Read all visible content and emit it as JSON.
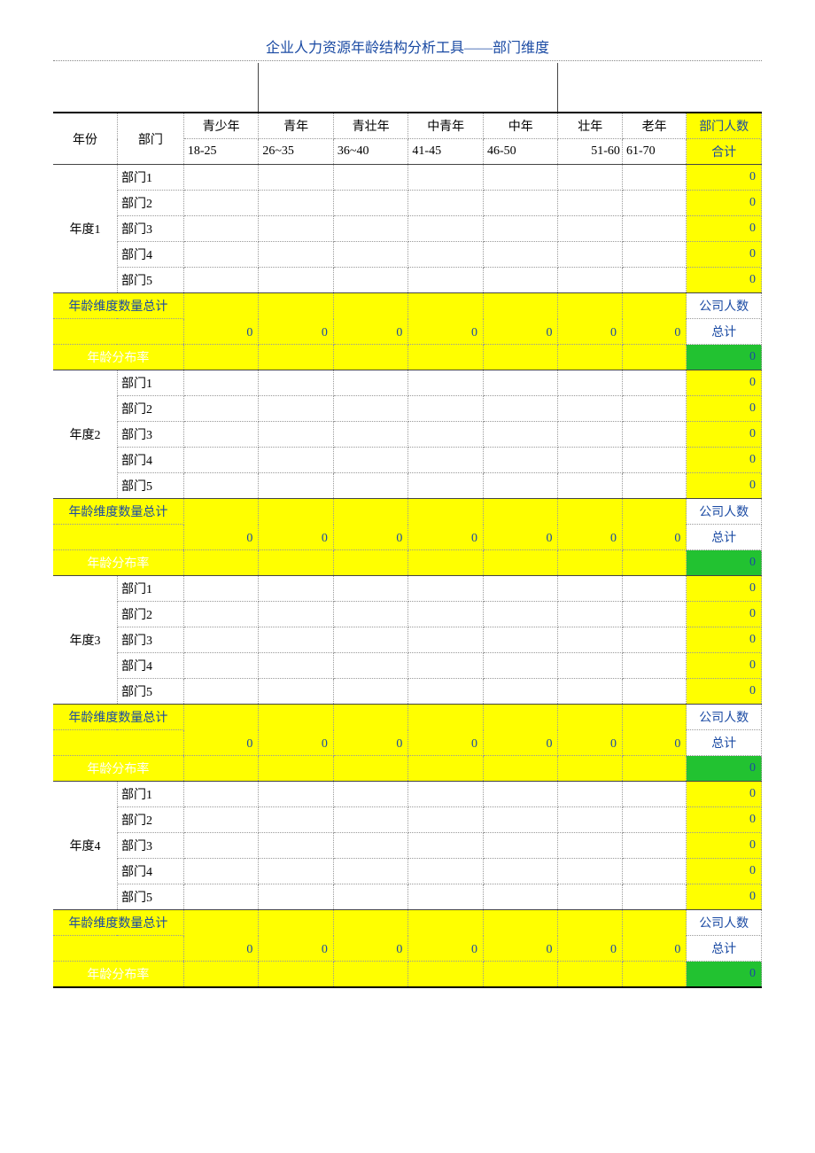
{
  "title": "企业人力资源年龄结构分析工具——部门维度",
  "headers": {
    "year": "年份",
    "dept": "部门",
    "age_groups": [
      "青少年",
      "青年",
      "青壮年",
      "中青年",
      "中年",
      "壮年",
      "老年"
    ],
    "age_ranges": [
      "18-25",
      "26~35",
      "36~40",
      "41-45",
      "46-50",
      "51-60",
      "61-70"
    ],
    "dept_total": "部门人数",
    "dept_total_sub": "合计"
  },
  "labels": {
    "age_sum": "年龄维度数量总计",
    "company_count": "公司人数",
    "company_total": "总计",
    "dist_rate": "年龄分布率"
  },
  "years": [
    {
      "name": "年度1",
      "depts": [
        "部门1",
        "部门2",
        "部门3",
        "部门4",
        "部门5"
      ],
      "dept_totals": [
        "0",
        "0",
        "0",
        "0",
        "0"
      ],
      "age_sums": [
        "0",
        "0",
        "0",
        "0",
        "0",
        "0",
        "0"
      ],
      "grand_total": "0"
    },
    {
      "name": "年度2",
      "depts": [
        "部门1",
        "部门2",
        "部门3",
        "部门4",
        "部门5"
      ],
      "dept_totals": [
        "0",
        "0",
        "0",
        "0",
        "0"
      ],
      "age_sums": [
        "0",
        "0",
        "0",
        "0",
        "0",
        "0",
        "0"
      ],
      "grand_total": "0"
    },
    {
      "name": "年度3",
      "depts": [
        "部门1",
        "部门2",
        "部门3",
        "部门4",
        "部门5"
      ],
      "dept_totals": [
        "0",
        "0",
        "0",
        "0",
        "0"
      ],
      "age_sums": [
        "0",
        "0",
        "0",
        "0",
        "0",
        "0",
        "0"
      ],
      "grand_total": "0"
    },
    {
      "name": "年度4",
      "depts": [
        "部门1",
        "部门2",
        "部门3",
        "部门4",
        "部门5"
      ],
      "dept_totals": [
        "0",
        "0",
        "0",
        "0",
        "0"
      ],
      "age_sums": [
        "0",
        "0",
        "0",
        "0",
        "0",
        "0",
        "0"
      ],
      "grand_total": "0"
    }
  ]
}
